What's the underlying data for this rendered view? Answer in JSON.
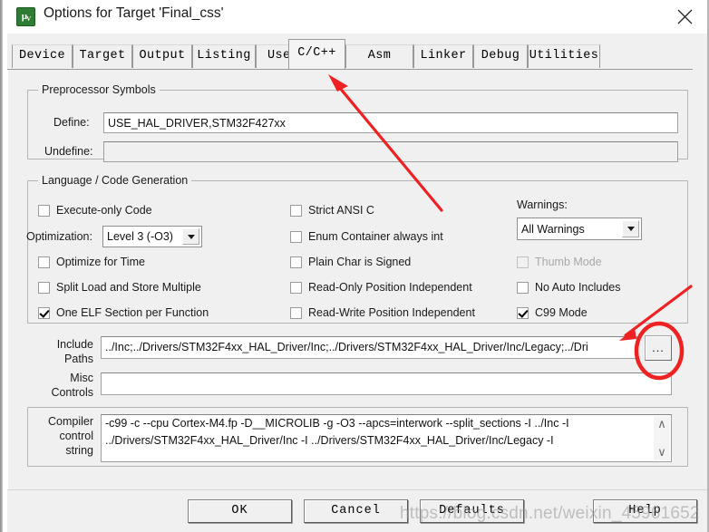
{
  "window": {
    "title": "Options for Target 'Final_css'",
    "icon": "keil-uvision-icon",
    "close_label": "close-icon"
  },
  "tabs": [
    {
      "label": "Device",
      "selected": false
    },
    {
      "label": "Target",
      "selected": false
    },
    {
      "label": "Output",
      "selected": false
    },
    {
      "label": "Listing",
      "selected": false
    },
    {
      "label": "User",
      "selected": false
    },
    {
      "label": "C/C++",
      "selected": true
    },
    {
      "label": "Asm",
      "selected": false
    },
    {
      "label": "Linker",
      "selected": false
    },
    {
      "label": "Debug",
      "selected": false
    },
    {
      "label": "Utilities",
      "selected": false
    }
  ],
  "preprocessor": {
    "group_label": "Preprocessor Symbols",
    "define_label": "Define:",
    "define_value": "USE_HAL_DRIVER,STM32F427xx",
    "undefine_label": "Undefine:",
    "undefine_value": ""
  },
  "language": {
    "group_label": "Language / Code Generation",
    "col1": [
      {
        "label": "Execute-only Code",
        "checked": false,
        "disabled": false
      },
      {
        "label": "Optimize for Time",
        "checked": false,
        "disabled": false
      },
      {
        "label": "Split Load and Store Multiple",
        "checked": false,
        "disabled": false
      },
      {
        "label": "One ELF Section per Function",
        "checked": true,
        "disabled": false
      }
    ],
    "optimization_label": "Optimization:",
    "optimization_value": "Level 3 (-O3)",
    "col2": [
      {
        "label": "Strict ANSI C",
        "checked": false,
        "disabled": false
      },
      {
        "label": "Enum Container always int",
        "checked": false,
        "disabled": false
      },
      {
        "label": "Plain Char is Signed",
        "checked": false,
        "disabled": false
      },
      {
        "label": "Read-Only Position Independent",
        "checked": false,
        "disabled": false
      },
      {
        "label": "Read-Write Position Independent",
        "checked": false,
        "disabled": false
      }
    ],
    "warnings_label": "Warnings:",
    "warnings_value": "All Warnings",
    "col3": [
      {
        "label": "Thumb Mode",
        "checked": false,
        "disabled": true
      },
      {
        "label": "No Auto Includes",
        "checked": false,
        "disabled": false
      },
      {
        "label": "C99 Mode",
        "checked": true,
        "disabled": false
      }
    ]
  },
  "paths": {
    "include_label_line1": "Include",
    "include_label_line2": "Paths",
    "include_value": "../Inc;../Drivers/STM32F4xx_HAL_Driver/Inc;../Drivers/STM32F4xx_HAL_Driver/Inc/Legacy;../Dri",
    "browse_label": "...",
    "misc_label_line1": "Misc",
    "misc_label_line2": "Controls",
    "misc_value": ""
  },
  "compiler": {
    "label_line1": "Compiler",
    "label_line2": "control",
    "label_line3": "string",
    "lines": [
      "-c99 -c --cpu Cortex-M4.fp -D__MICROLIB -g -O3 --apcs=interwork --split_sections -I ../Inc -I",
      "../Drivers/STM32F4xx_HAL_Driver/Inc -I ../Drivers/STM32F4xx_HAL_Driver/Inc/Legacy -I"
    ],
    "scroll_up": "∧",
    "scroll_down": "∨"
  },
  "buttons": [
    {
      "label": "OK"
    },
    {
      "label": "Cancel"
    },
    {
      "label": "Defaults"
    },
    {
      "label": "Help"
    }
  ],
  "annotations": {
    "color": "#ee2222",
    "arrow_to_tab": "red-arrow-pointing-to-cpp-tab",
    "arrow_to_browse": "red-arrow-pointing-to-browse-button",
    "ellipse_browse": "red-ellipse-around-browse-button"
  },
  "watermark": {
    "text": "https://blog.csdn.net/weixin_45961652"
  }
}
